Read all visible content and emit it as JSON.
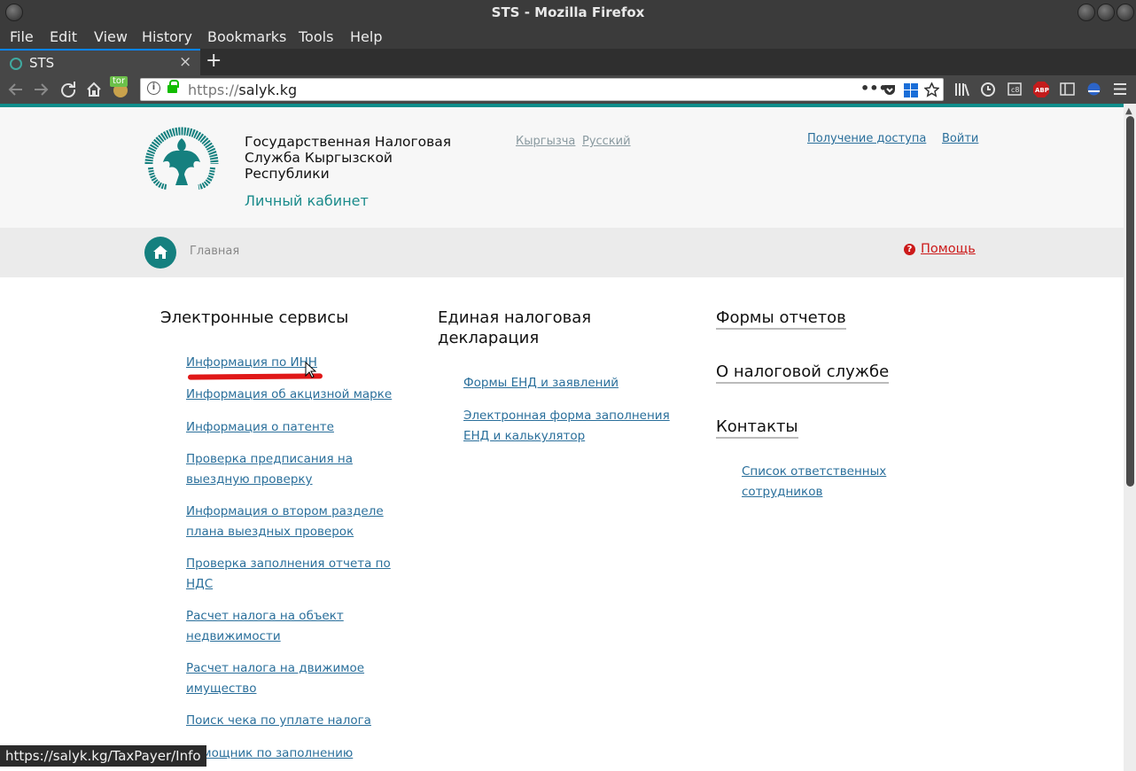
{
  "window": {
    "title": "STS - Mozilla Firefox"
  },
  "menu": [
    "File",
    "Edit",
    "View",
    "History",
    "Bookmarks",
    "Tools",
    "Help"
  ],
  "tab": {
    "title": "STS",
    "close": "×",
    "new_tab": "+"
  },
  "toolbar": {
    "tor_badge": "tor",
    "url_protocol": "https://",
    "url_host": "salyk.kg",
    "more": "•••"
  },
  "header": {
    "org_name": "Государственная Налоговая Служба Кыргызской Республики",
    "cabinet": "Личный кабинет",
    "lang_ky": "Кыргызча",
    "lang_ru": "Русский",
    "access": "Получение доступа",
    "login": "Войти"
  },
  "breadcrumb": {
    "home": "Главная",
    "help": "Помощь"
  },
  "services": {
    "title": "Электронные сервисы",
    "items": [
      "Информация по ИНН",
      "Информация об акцизной марке",
      "Информация о патенте",
      "Проверка предписания на выездную проверку",
      "Информация о втором разделе плана выездных проверок",
      "Проверка заполнения отчета по НДС",
      "Расчет налога на объект недвижимости",
      "Расчет налога на движимое имущество",
      "Поиск чека по уплате налога",
      "Помощник по заполнению"
    ]
  },
  "declaration": {
    "title": "Единая налоговая декларация",
    "items": [
      "Формы ЕНД и заявлений",
      "Электронная форма заполнения ЕНД и калькулятор"
    ]
  },
  "reports": {
    "title": "Формы отчетов"
  },
  "about": {
    "title": "О налоговой службе"
  },
  "contacts": {
    "title": "Контакты",
    "items": [
      "Список ответственных сотрудников"
    ]
  },
  "status": {
    "link_url": "https://salyk.kg/TaxPayer/Info"
  },
  "colors": {
    "accent": "#15807f",
    "link": "#2a6f9b",
    "help": "#cc1a1a"
  }
}
